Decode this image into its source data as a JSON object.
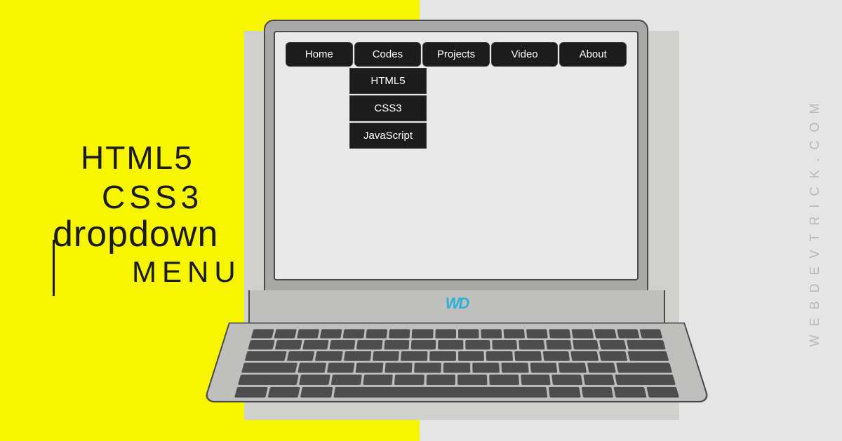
{
  "title": {
    "line1": "HTML5",
    "line2": "CSS3",
    "line3": "dropdown",
    "line4": "MENU"
  },
  "nav": [
    {
      "label": "Home"
    },
    {
      "label": "Codes"
    },
    {
      "label": "Projects"
    },
    {
      "label": "Video"
    },
    {
      "label": "About"
    }
  ],
  "dropdown": [
    {
      "label": "HTML5"
    },
    {
      "label": "CSS3"
    },
    {
      "label": "JavaScript"
    }
  ],
  "logo": "WD",
  "watermark": "WEBDEVTRICK.COM"
}
